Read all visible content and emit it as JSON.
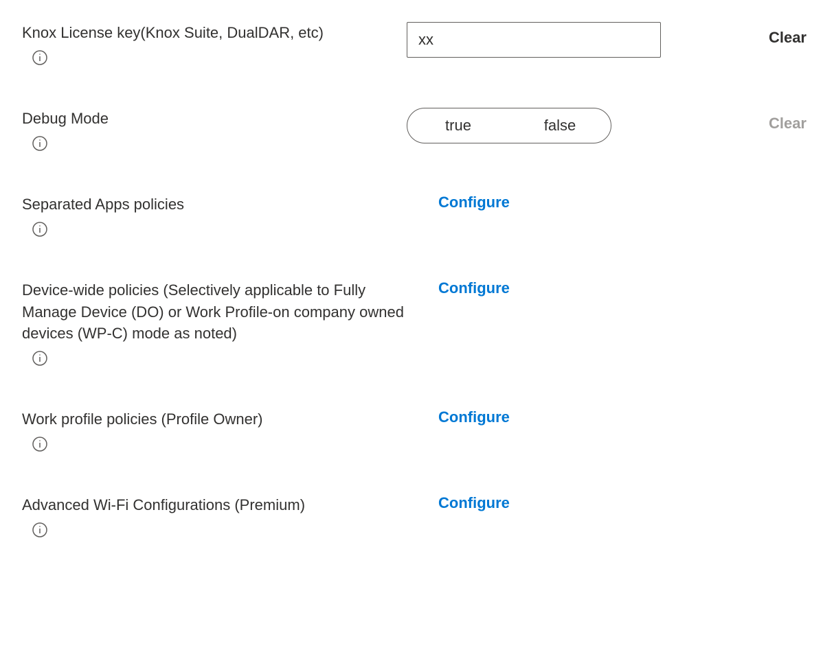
{
  "rows": {
    "knox_license": {
      "label": "Knox License key(Knox Suite, DualDAR, etc)",
      "value": "xx",
      "clear": "Clear"
    },
    "debug_mode": {
      "label": "Debug Mode",
      "option_true": "true",
      "option_false": "false",
      "clear": "Clear"
    },
    "separated_apps": {
      "label": "Separated Apps policies",
      "action": "Configure"
    },
    "device_wide": {
      "label": "Device-wide policies (Selectively applicable to Fully Manage Device (DO) or Work Profile-on company owned devices (WP-C) mode as noted)",
      "action": "Configure"
    },
    "work_profile": {
      "label": "Work profile policies (Profile Owner)",
      "action": "Configure"
    },
    "wifi_config": {
      "label": "Advanced Wi-Fi Configurations (Premium)",
      "action": "Configure"
    }
  }
}
